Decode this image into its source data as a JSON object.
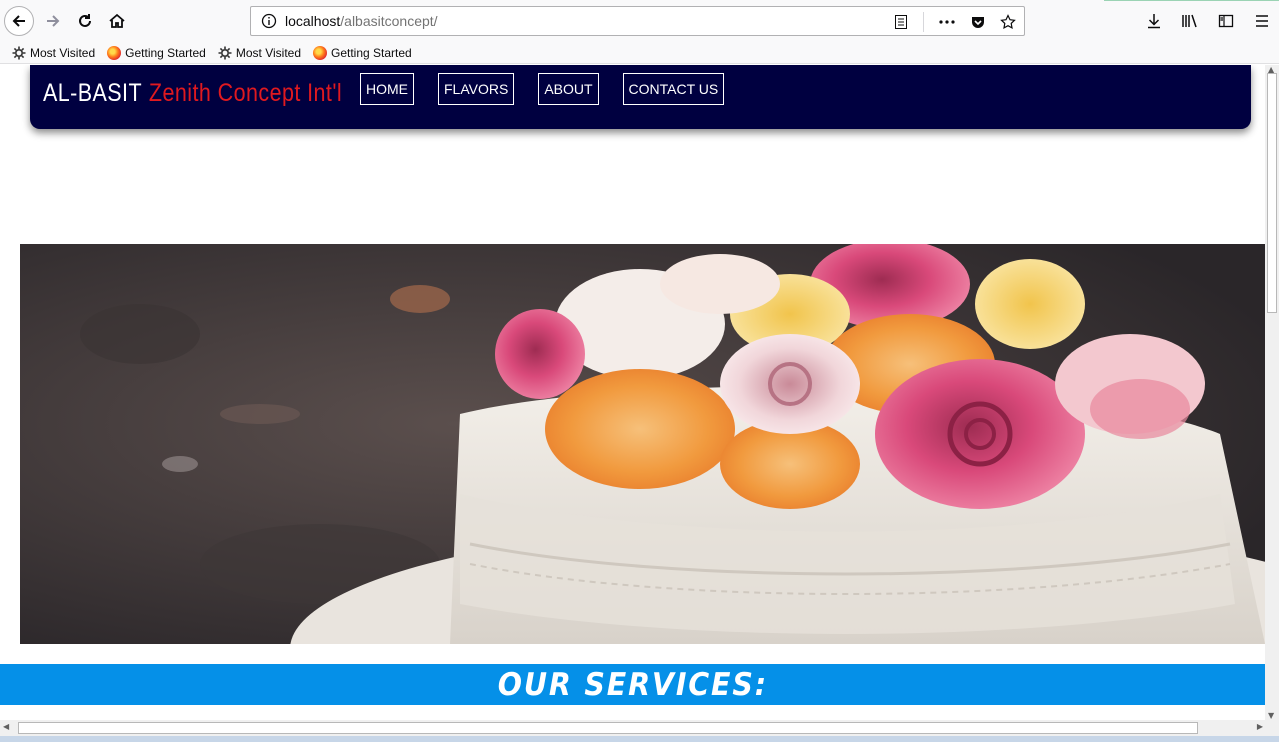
{
  "browser": {
    "url_host": "localhost",
    "url_path": "/albasitconcept/",
    "bookmarks": [
      {
        "label": "Most Visited",
        "icon": "gear-icon"
      },
      {
        "label": "Getting Started",
        "icon": "firefox-icon"
      },
      {
        "label": "Most Visited",
        "icon": "gear-icon"
      },
      {
        "label": "Getting Started",
        "icon": "firefox-icon"
      }
    ]
  },
  "site": {
    "brand_main": "AL-BASIT",
    "brand_sub": "Zenith Concept Int'l",
    "menu": [
      "HOME",
      "FLAVORS",
      "ABOUT",
      "CONTACT US"
    ],
    "services_heading": "OUR SERVICES:"
  },
  "colors": {
    "navbar": "#000040",
    "brand_accent": "#e0191f",
    "services_bar": "#0590e8"
  }
}
